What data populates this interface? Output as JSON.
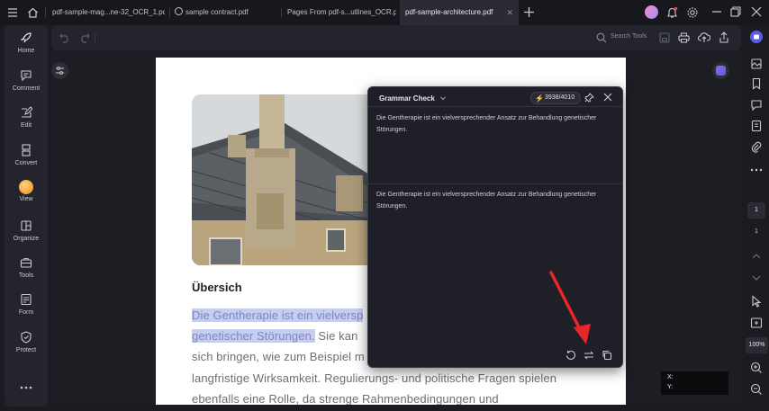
{
  "tabs": [
    {
      "label": "pdf-sample-mag...ne-32_OCR_1.pdf"
    },
    {
      "label": "sample contract.pdf"
    },
    {
      "label": "Pages From pdf-s...utlines_OCR.pdf"
    },
    {
      "label": "pdf-sample-architecture.pdf"
    }
  ],
  "nav": [
    {
      "label": "Home",
      "icon": "rocket-icon"
    },
    {
      "label": "Comment",
      "icon": "comment-icon"
    },
    {
      "label": "Edit",
      "icon": "edit-icon"
    },
    {
      "label": "Convert",
      "icon": "convert-icon"
    },
    {
      "label": "View",
      "icon": "view-icon"
    },
    {
      "label": "Organize",
      "icon": "organize-icon"
    },
    {
      "label": "Tools",
      "icon": "toolbox-icon"
    },
    {
      "label": "Form",
      "icon": "form-icon"
    },
    {
      "label": "Protect",
      "icon": "shield-icon"
    }
  ],
  "toolbar": {
    "search_label": "Search Tools"
  },
  "document": {
    "heading": "Übersich",
    "line1_highlight": "Die Gentherapie ist ein vielversp",
    "line2_highlight": "genetischer Störungen.",
    "line2_rest": " Sie kan",
    "line3": "sich bringen, wie zum Beispiel m",
    "line4": "langfristige Wirksamkeit. Regulierungs- und politische Fragen spielen",
    "line5": "ebenfalls eine Rolle, da strenge Rahmenbedingungen und"
  },
  "grammar": {
    "title": "Grammar Check",
    "credits": "3938/4010",
    "original_text": "Die Gentherapie ist ein vielversprechender Ansatz zur Behandlung genetischer Störungen.",
    "result_text": "Die Gentherapie ist ein vielversprechender Ansatz zur Behandlung genetischer Störungen."
  },
  "pager": {
    "current_page": "1",
    "total_pages": "1",
    "zoom": "100%"
  },
  "coords": {
    "x_label": "X:",
    "y_label": "Y:"
  },
  "colors": {
    "accent": "#5b5ce6",
    "highlight": "#c5cdf0",
    "arrow": "#e8262a"
  }
}
